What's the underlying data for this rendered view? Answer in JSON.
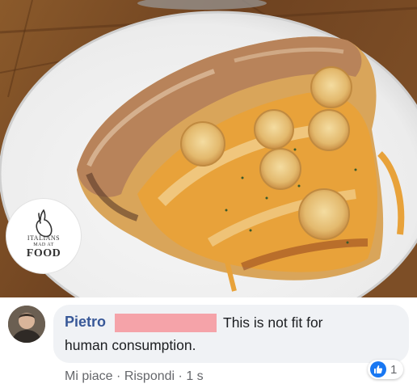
{
  "watermark": {
    "line1": "ITALIANS",
    "line2": "MAD AT",
    "line3": "FOOD",
    "icon": "pinched-fingers-hand-icon"
  },
  "comment": {
    "author": "Pietro",
    "text_line1": "This is not fit for",
    "text_line2": "human consumption.",
    "reaction_icon": "thumbs-up-icon",
    "reaction_count": "1",
    "like_label": "Mi piace",
    "reply_label": "Rispondi",
    "separator": "·",
    "time": "1 s"
  },
  "colors": {
    "author": "#385898",
    "bubble": "#f0f2f5",
    "redaction": "#f5a3a9",
    "like_blue": "#1877f2",
    "muted_text": "#65676b"
  }
}
